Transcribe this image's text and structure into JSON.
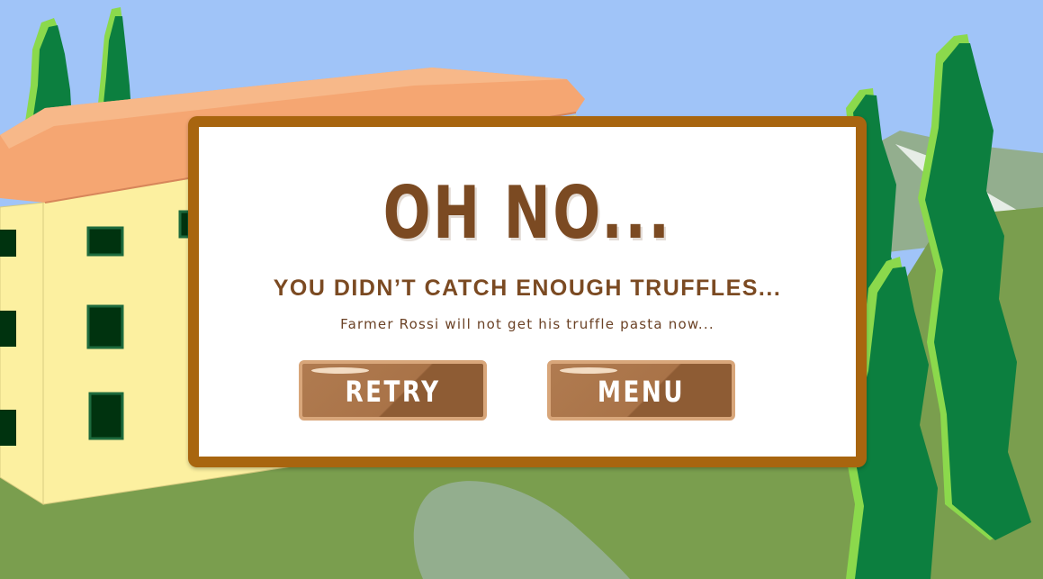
{
  "dialog": {
    "title": "OH NO...",
    "subtitle": "YOU DIDN’T CATCH ENOUGH TRUFFLES...",
    "message": "Farmer Rossi will not get his truffle pasta now...",
    "retry_label": "RETRY",
    "menu_label": "MENU"
  },
  "colors": {
    "sky": "#A0C4F8",
    "grass": "#7A9E4E",
    "roof": "#F5A672",
    "villa_wall": "#FCF0A0",
    "cypress_dark": "#0C7F3F",
    "cypress_light": "#8BD94C",
    "dialog_border": "#A8650F",
    "title_text": "#7B4A22",
    "button_fill": "#A97348"
  },
  "icons": [
    "villa-building",
    "cypress-tree",
    "path"
  ]
}
